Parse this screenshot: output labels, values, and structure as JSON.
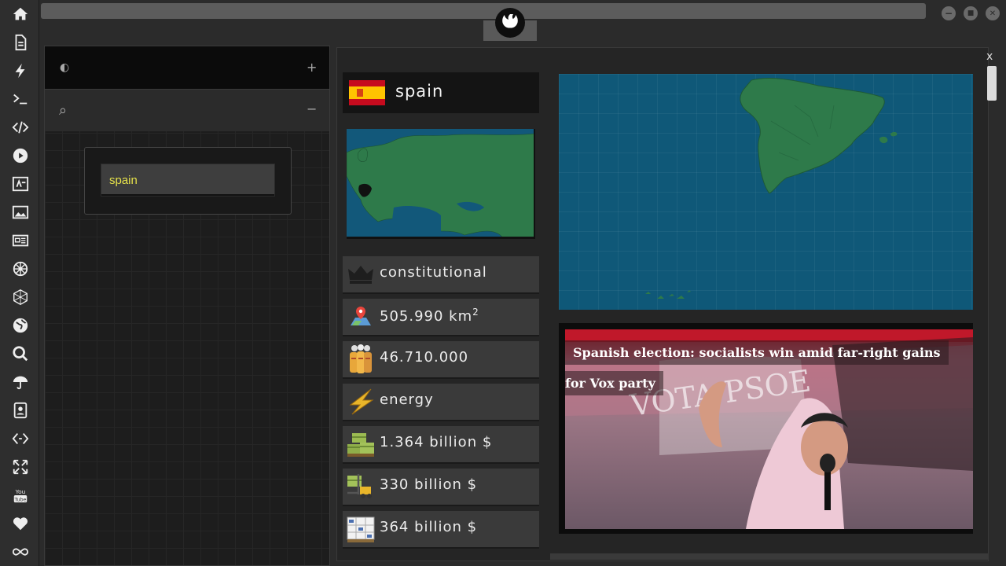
{
  "sidebar": {
    "icons": [
      "home-icon",
      "document-icon",
      "lightning-icon",
      "terminal-icon",
      "code-icon",
      "play-icon",
      "translate-icon",
      "image-icon",
      "newspaper-icon",
      "empire-icon",
      "network-icon",
      "globe-icon",
      "search-icon",
      "umbrella-icon",
      "contacts-icon",
      "arrows-swap-icon",
      "fullscreen-icon",
      "youtube-icon",
      "heart-icon",
      "infinity-icon"
    ]
  },
  "window": {
    "minimize": "−",
    "maximize": "■",
    "close": "✕"
  },
  "left_panel": {
    "toggle_icon": "◐",
    "add_label": "+",
    "search_icon": "⌕",
    "collapse_label": "−",
    "search_value": "spain"
  },
  "main": {
    "close_label": "x",
    "country": "spain",
    "stats": [
      {
        "icon": "crown-icon",
        "label": "constitutional"
      },
      {
        "icon": "map-pin-icon",
        "label": "505.990 km",
        "sup": "2"
      },
      {
        "icon": "population-icon",
        "label": "46.710.000"
      },
      {
        "icon": "energy-icon",
        "label": "energy"
      },
      {
        "icon": "cargo-icon",
        "label": "1.364 billion $"
      },
      {
        "icon": "forklift-icon",
        "label": "330 billion $"
      },
      {
        "icon": "boxes-icon",
        "label": "364 billion $"
      }
    ],
    "news": {
      "headline_line1": "Spanish election: socialists win amid far-right gains",
      "headline_line2": "for Vox party",
      "banner_text": "VOTA PSOE"
    }
  },
  "colors": {
    "accent_yellow": "#e6e24a",
    "map_water": "#0f5878",
    "map_land": "#2e7a4a"
  }
}
